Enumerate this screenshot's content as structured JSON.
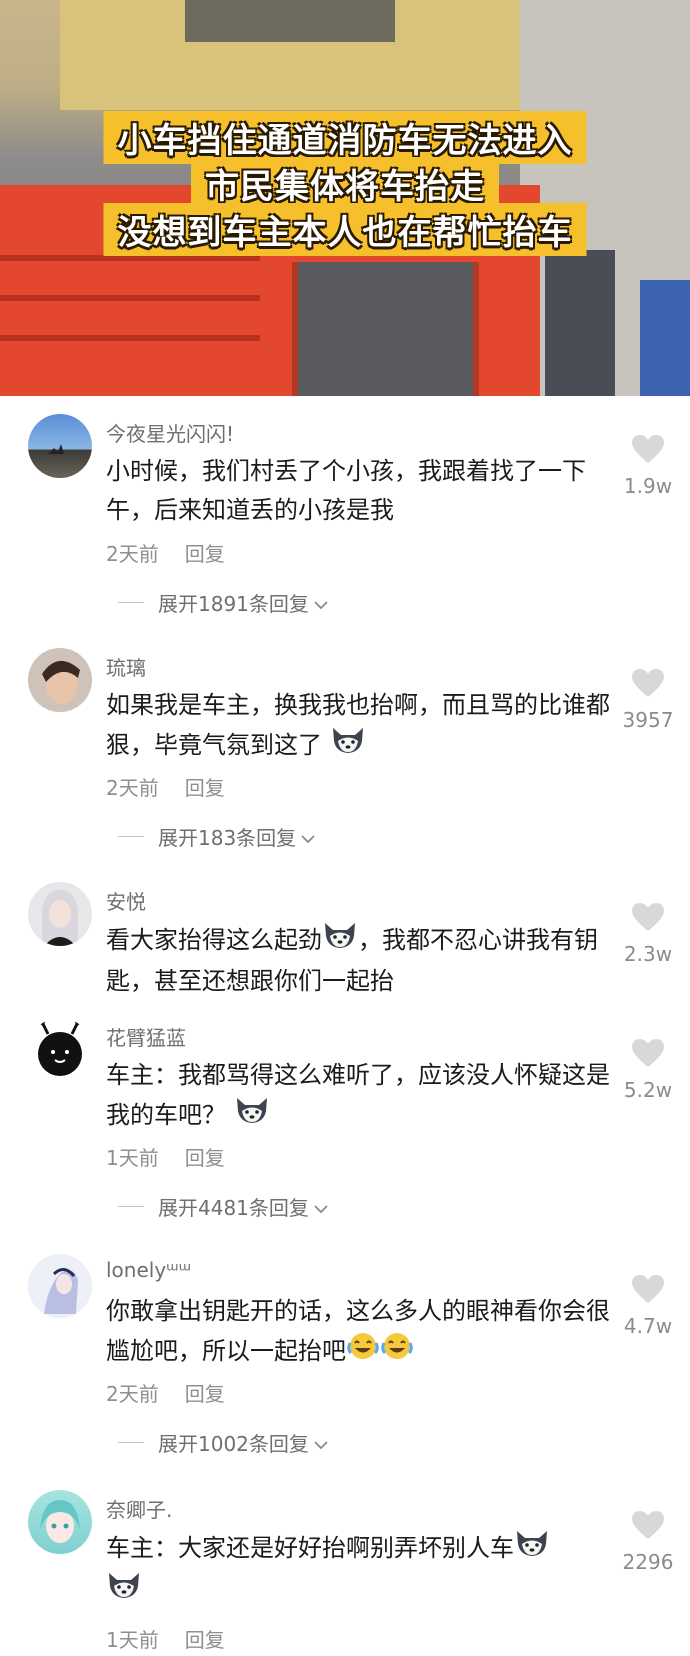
{
  "video": {
    "caption_lines": [
      "小车挡住通道消防车无法进入",
      "市民集体将车抬走",
      "没想到车主本人也在帮忙抬车"
    ]
  },
  "comments": [
    {
      "username": "今夜星光闪闪!",
      "text": "小时候，我们村丢了个小孩，我跟着找了一下午，后来知道丢的小孩是我",
      "time": "2天前",
      "reply_label": "回复",
      "likes": "1.9w",
      "expand_label": "展开1891条回复"
    },
    {
      "username": "琉璃",
      "text": "如果我是车主，换我我也抬啊，而且骂的比谁都狠，毕竟气氛到这了",
      "time": "2天前",
      "reply_label": "回复",
      "likes": "3957",
      "expand_label": "展开183条回复"
    },
    {
      "username": "安悦",
      "text_a": "看大家抬得这么起劲",
      "text_b": "，我都不忍心讲我有钥匙，甚至还想跟你们一起抬",
      "likes": "2.3w"
    },
    {
      "username": "花臂猛蓝",
      "text": "车主：我都骂得这么难听了，应该没人怀疑这是我的车吧？",
      "time": "1天前",
      "reply_label": "回复",
      "likes": "5.2w",
      "expand_label": "展开4481条回复"
    },
    {
      "username": "lonelyᵚᵚ",
      "text": "你敢拿出钥匙开的话，这么多人的眼神看你会很尴尬吧，所以一起抬吧",
      "time": "2天前",
      "reply_label": "回复",
      "likes": "4.7w",
      "expand_label": "展开1002条回复"
    },
    {
      "username": "奈卿子.",
      "text": "车主：大家还是好好抬啊别弄坏别人车",
      "time": "1天前",
      "reply_label": "回复",
      "likes": "2296"
    }
  ],
  "colors": {
    "caption_bg": "#f5c02c",
    "like_icon": "#d8d8d8",
    "meta_text": "#8f8f8f"
  }
}
